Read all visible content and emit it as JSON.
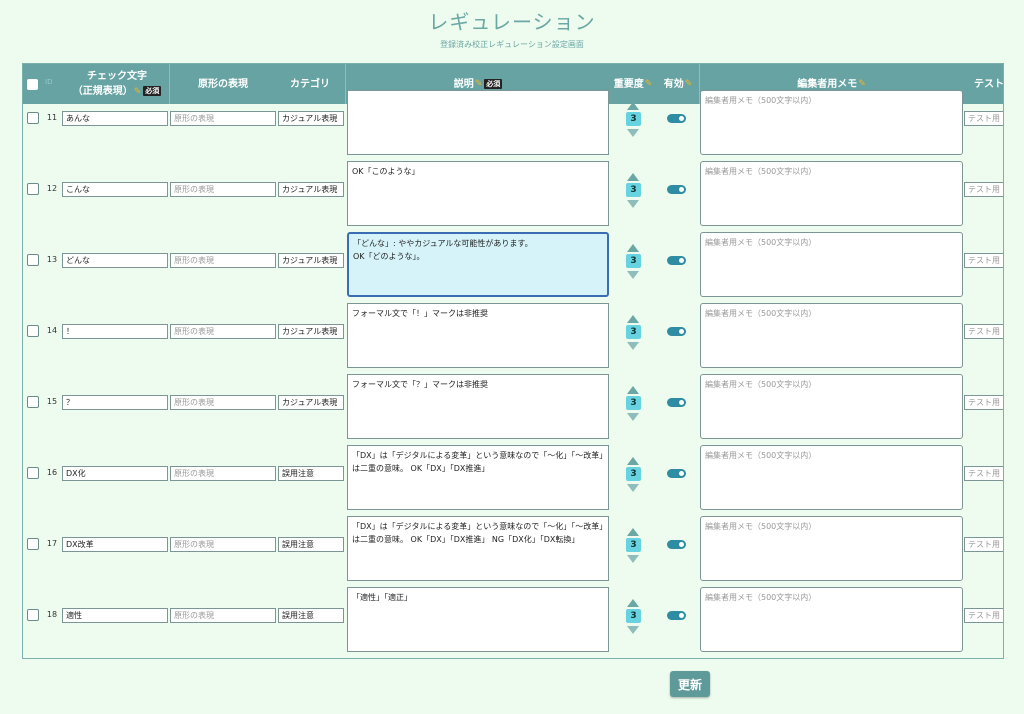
{
  "page": {
    "title": "レギュレーション",
    "subtitle": "登録済み校正レギュレーション設定画面"
  },
  "headers": {
    "id": "ID",
    "check_text_line1": "チェック文字",
    "check_text_line2": "（正規表現）",
    "original_form": "原形の表現",
    "category": "カテゴリ",
    "description": "説明",
    "severity": "重要度",
    "enabled": "有効",
    "editor_memo": "編集者用メモ",
    "test": "テスト",
    "required_badge": "必須"
  },
  "placeholders": {
    "original_form": "原形の表現",
    "editor_memo": "編集者用メモ（500文字以内）",
    "test": "テスト用(",
    "test_prefix": "テスト用"
  },
  "rows": [
    {
      "id": "11",
      "check_text": "あんな",
      "category": "カジュアル表現",
      "description": "",
      "severity": "3",
      "enabled": true
    },
    {
      "id": "12",
      "check_text": "こんな",
      "category": "カジュアル表現",
      "description": "OK「このような」",
      "severity": "3",
      "enabled": true
    },
    {
      "id": "13",
      "check_text": "どんな",
      "category": "カジュアル表現",
      "description": "「どんな」: ややカジュアルな可能性があります。\nOK「どのような」。",
      "severity": "3",
      "enabled": true
    },
    {
      "id": "14",
      "check_text": "！",
      "category": "カジュアル表現",
      "description": "フォーマル文で「！」マークは非推奨",
      "severity": "3",
      "enabled": true
    },
    {
      "id": "15",
      "check_text": "？",
      "category": "カジュアル表現",
      "description": "フォーマル文で「？」マークは非推奨",
      "severity": "3",
      "enabled": true
    },
    {
      "id": "16",
      "check_text": "DX化",
      "category": "誤用注意",
      "description": "「DX」は「デジタルによる変革」という意味なので「〜化」「〜改革」は二重の意味。 OK「DX」「DX推進」",
      "severity": "3",
      "enabled": true
    },
    {
      "id": "17",
      "check_text": "DX改革",
      "category": "誤用注意",
      "description": "「DX」は「デジタルによる変革」という意味なので「〜化」「〜改革」は二重の意味。 OK「DX」「DX推進」 NG「DX化」「DX転換」",
      "severity": "3",
      "enabled": true
    },
    {
      "id": "18",
      "check_text": "適性",
      "category": "誤用注意",
      "description": "「適性」「適正」",
      "severity": "3",
      "enabled": true
    },
    {
      "id": "",
      "check_text": "",
      "category": "",
      "description": "「適性」「適正」",
      "severity": "",
      "enabled": true
    }
  ],
  "actions": {
    "update_label": "更新"
  },
  "colors": {
    "header_bg": "#66a3a2",
    "page_bg": "#eefcef",
    "accent": "#6aa7a5",
    "severity_badge": "#67d3e0",
    "toggle_on": "#2f8da3"
  }
}
